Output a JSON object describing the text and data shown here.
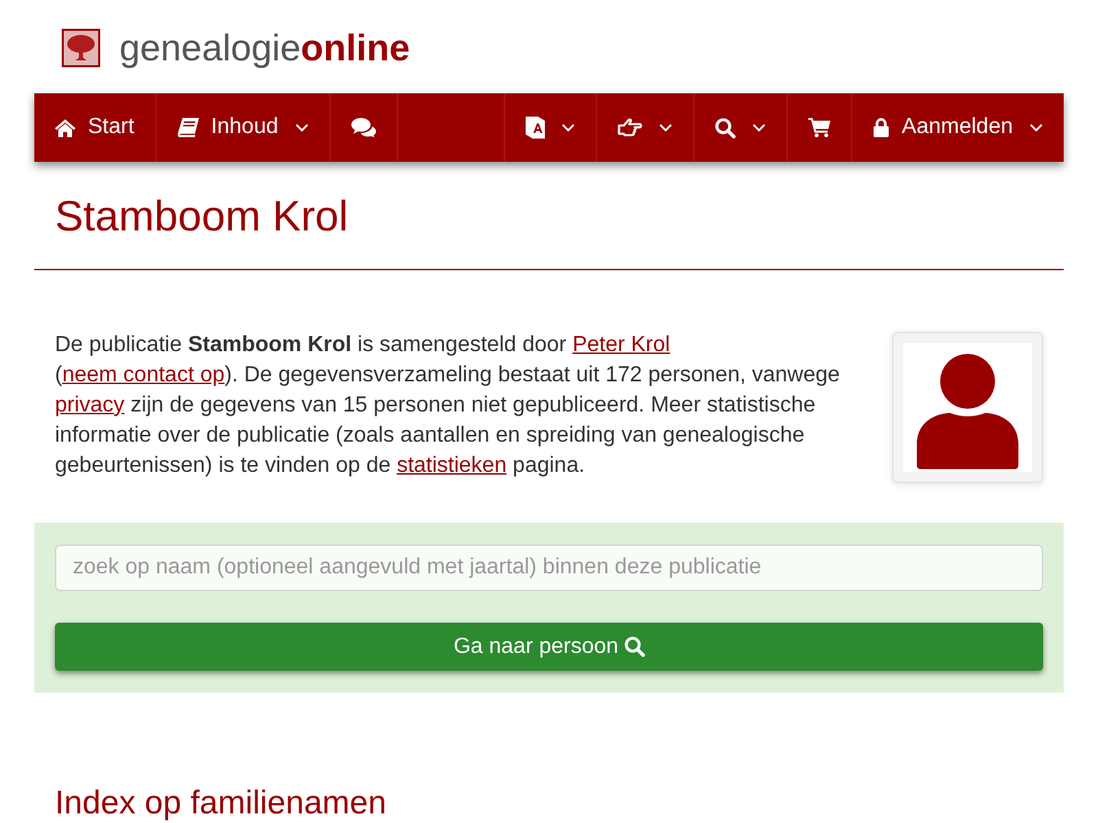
{
  "header": {
    "logo": "genealogie**online**"
  },
  "nav": {
    "left": [
      {
        "kind": "home",
        "label": "Start",
        "dropdown": false
      },
      {
        "kind": "book",
        "label": "Inhoud",
        "dropdown": true
      },
      {
        "kind": "chat",
        "dropdown": false
      }
    ],
    "right": [
      {
        "kind": "translate",
        "dropdown": true
      },
      {
        "kind": "hand",
        "dropdown": true
      },
      {
        "kind": "search",
        "dropdown": true
      },
      {
        "kind": "cart",
        "dropdown": false
      },
      {
        "kind": "lock",
        "label": "Aanmelden",
        "dropdown": true
      }
    ]
  },
  "title": "Stamboom Krol",
  "intro": [
    {
      "kind": "text",
      "text": "De publicatie **Stamboom Krol** is samengesteld door "
    },
    {
      "kind": "link",
      "text": "Peter Krol"
    },
    {
      "kind": "text",
      "text": " ("
    },
    {
      "kind": "link",
      "text": "neem contact op"
    },
    {
      "kind": "text",
      "text": "). De gegevensverzameling bestaat uit 172 personen, vanwege "
    },
    {
      "kind": "link",
      "text": "privacy"
    },
    {
      "kind": "text",
      "text": " zijn de gegevens van 15 personen niet gepubliceerd. Meer statistische informatie over de publicatie (zoals aantallen en spreiding van genealogische gebeurtenissen) is te vinden op de "
    },
    {
      "kind": "link",
      "text": "statistieken"
    },
    {
      "kind": "text",
      "text": " pagina."
    }
  ],
  "search": {
    "placeholder": "zoek op naam (optioneel aangevuld met jaartal) binnen deze publicatie",
    "button": "Ga naar persoon"
  },
  "section_heading": "Index op familienamen"
}
